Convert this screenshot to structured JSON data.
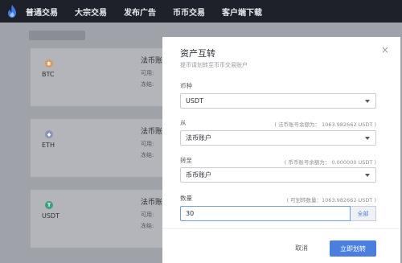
{
  "nav": {
    "items": [
      "普通交易",
      "大宗交易",
      "发布广告",
      "币币交易",
      "客户端下载"
    ]
  },
  "assets": [
    {
      "name": "BTC",
      "icon": "bitcoin-icon",
      "color": "#d89b5d",
      "card_title": "法币账",
      "line1": "可用:",
      "line2": "冻结:"
    },
    {
      "name": "ETH",
      "icon": "ethereum-icon",
      "color": "#8c93b8",
      "card_title": "法币账",
      "line1": "可用:",
      "line2": "冻结:"
    },
    {
      "name": "USDT",
      "icon": "tether-icon",
      "color": "#3f9e7c",
      "card_title": "法币账",
      "line1": "可用:",
      "line2": "冻结:"
    }
  ],
  "modal": {
    "title": "资产互转",
    "subtitle": "提币请划转至币币交易账户",
    "close": "×",
    "currency_label": "币种",
    "currency_value": "USDT",
    "from_label": "从",
    "from_hint": "( 法币账号余额为： 1063.982662 USDT )",
    "from_value": "法币账户",
    "to_label": "转至",
    "to_hint": "( 币币账号余额为： 0.000000 USDT )",
    "to_value": "币币账户",
    "amount_label": "数量",
    "amount_hint": "( 可划转数量：1063.982662 USDT )",
    "amount_value": "30",
    "all_button": "全部",
    "cancel_button": "取消",
    "confirm_button": "立即划转"
  },
  "colors": {
    "accent": "#4a7fe0",
    "nav_bg": "#1e2129"
  }
}
